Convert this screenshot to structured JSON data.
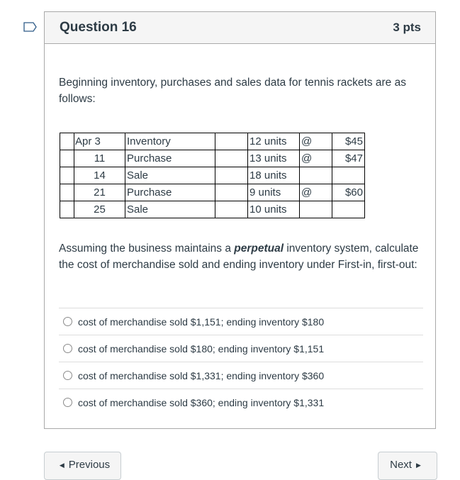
{
  "question": {
    "title": "Question 16",
    "points": "3 pts",
    "flag_icon": "bookmark-flag-icon",
    "intro": "Beginning inventory, purchases and sales data for tennis rackets are as follows:",
    "prompt_before": "Assuming the business maintains a ",
    "prompt_emphasis": "perpetual",
    "prompt_after": " inventory system, calculate the cost of merchandise sold and ending inventory under First-in, first-out:"
  },
  "table": {
    "rows": [
      {
        "date": "Apr 3",
        "type": "Inventory",
        "units": "12 units",
        "at": "@",
        "price": "$45"
      },
      {
        "date": "11",
        "type": "Purchase",
        "units": "13 units",
        "at": "@",
        "price": "$47"
      },
      {
        "date": "14",
        "type": "Sale",
        "units": "18 units",
        "at": "",
        "price": ""
      },
      {
        "date": "21",
        "type": "Purchase",
        "units": "9 units",
        "at": "@",
        "price": "$60"
      },
      {
        "date": "25",
        "type": "Sale",
        "units": "10 units",
        "at": "",
        "price": ""
      }
    ]
  },
  "answers": [
    {
      "label": "cost of merchandise sold $1,151; ending inventory $180",
      "selected": false
    },
    {
      "label": "cost of merchandise sold $180; ending inventory $1,151",
      "selected": false
    },
    {
      "label": "cost of merchandise sold $1,331; ending inventory $360",
      "selected": false
    },
    {
      "label": "cost of merchandise sold $360; ending inventory $1,331",
      "selected": false
    }
  ],
  "nav": {
    "previous_label": "Previous",
    "previous_icon": "triangle-left-icon",
    "next_label": "Next",
    "next_icon": "triangle-right-icon"
  }
}
